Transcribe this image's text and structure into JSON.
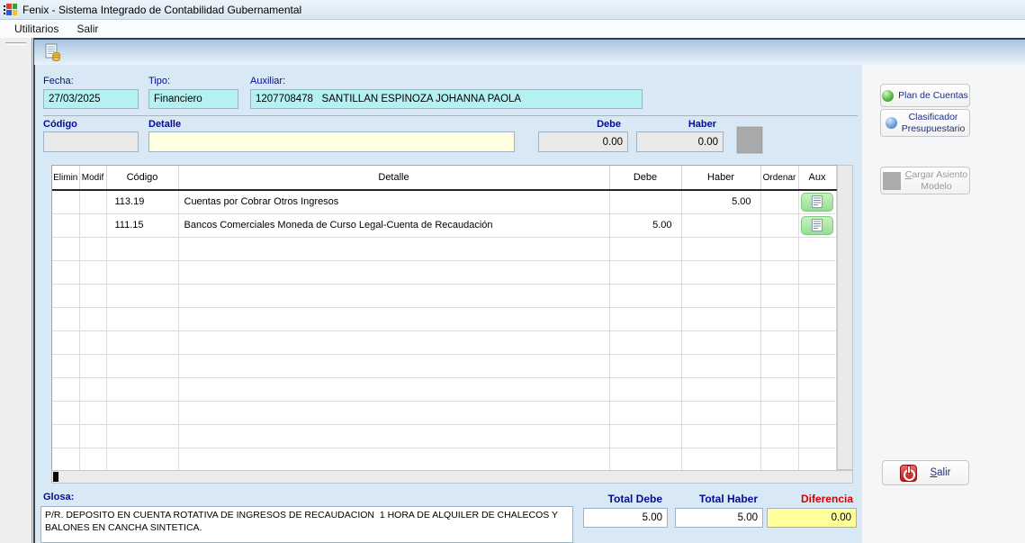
{
  "window": {
    "title": "Fenix - Sistema Integrado de Contabilidad Gubernamental"
  },
  "menu": {
    "utilitarios": "Utilitarios",
    "salir": "Salir"
  },
  "header_fields": {
    "fecha_label": "Fecha:",
    "fecha_value": "27/03/2025",
    "tipo_label": "Tipo:",
    "tipo_value": "Financiero",
    "auxiliar_label": "Auxiliar:",
    "auxiliar_value": "1207708478   SANTILLAN ESPINOZA JOHANNA PAOLA"
  },
  "entry_fields": {
    "codigo_label": "Código",
    "codigo_value": "",
    "detalle_label": "Detalle",
    "detalle_value": "",
    "debe_label": "Debe",
    "debe_value": "0.00",
    "haber_label": "Haber",
    "haber_value": "0.00"
  },
  "table": {
    "headers": {
      "elimin": "Elimin",
      "modif": "Modif",
      "codigo": "Código",
      "detalle": "Detalle",
      "debe": "Debe",
      "haber": "Haber",
      "ordenar": "Ordenar",
      "aux": "Aux"
    },
    "rows": [
      {
        "codigo": "113.19",
        "detalle": "Cuentas por Cobrar Otros Ingresos",
        "debe": "",
        "haber": "5.00"
      },
      {
        "codigo": "111.15",
        "detalle": "Bancos Comerciales Moneda de Curso Legal-Cuenta de Recaudación",
        "debe": "5.00",
        "haber": ""
      }
    ],
    "empty_rows": 10
  },
  "side_panel": {
    "plan_de_cuentas": {
      "label": "Plan de Cuentas",
      "icon": "green-sphere-icon"
    },
    "clasificador": {
      "line1": "Clasificador",
      "line2": "Presupuestario",
      "icon": "blue-sphere-icon"
    },
    "cargar_asiento": {
      "accel": "C",
      "line1_rest": "argar Asiento",
      "line2": "Modelo",
      "icon": "gray-square-icon"
    },
    "salir": {
      "accel": "S",
      "rest": "alir",
      "icon": "power-icon"
    }
  },
  "footer": {
    "glosa_label": "Glosa:",
    "glosa_text": "P/R. DEPOSITO EN CUENTA ROTATIVA DE INGRESOS DE RECAUDACION  1 HORA DE ALQUILER DE CHALECOS Y BALONES EN CANCHA SINTETICA.",
    "total_debe_label": "Total Debe",
    "total_debe_value": "5.00",
    "total_haber_label": "Total Haber",
    "total_haber_value": "5.00",
    "diferencia_label": "Diferencia",
    "diferencia_value": "0.00"
  },
  "colors": {
    "label_navy": "#000D94",
    "cyan_field": "#B5F1F1",
    "detalle_yellow": "#FFFFE1",
    "diferencia_yellow": "#FFFF99",
    "diferencia_red": "#D90000",
    "aux_green": "#94DE92",
    "toolbar_blue": "#A9C4DF"
  }
}
